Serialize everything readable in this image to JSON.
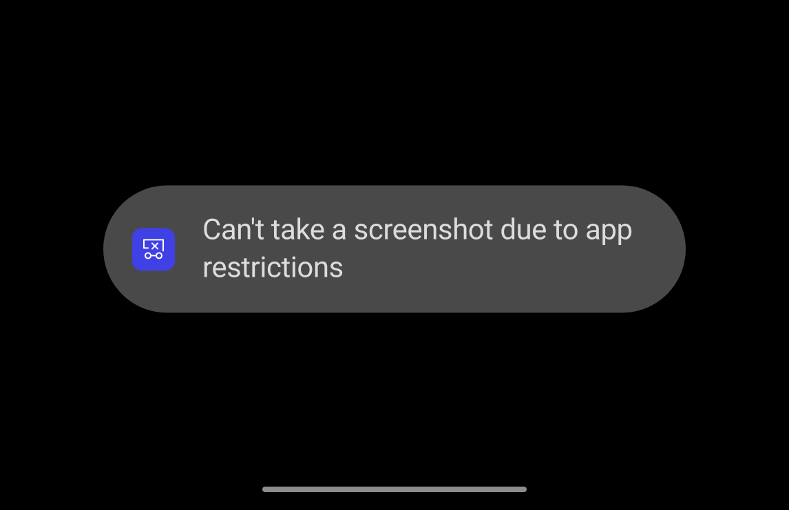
{
  "toast": {
    "message": "Can't take a screenshot due to app restrictions",
    "icon": "screenshot-blocked-icon",
    "icon_bg_color": "#4041e5",
    "bg_color": "#494949",
    "text_color": "#dcdcdc"
  },
  "background_color": "#000000"
}
